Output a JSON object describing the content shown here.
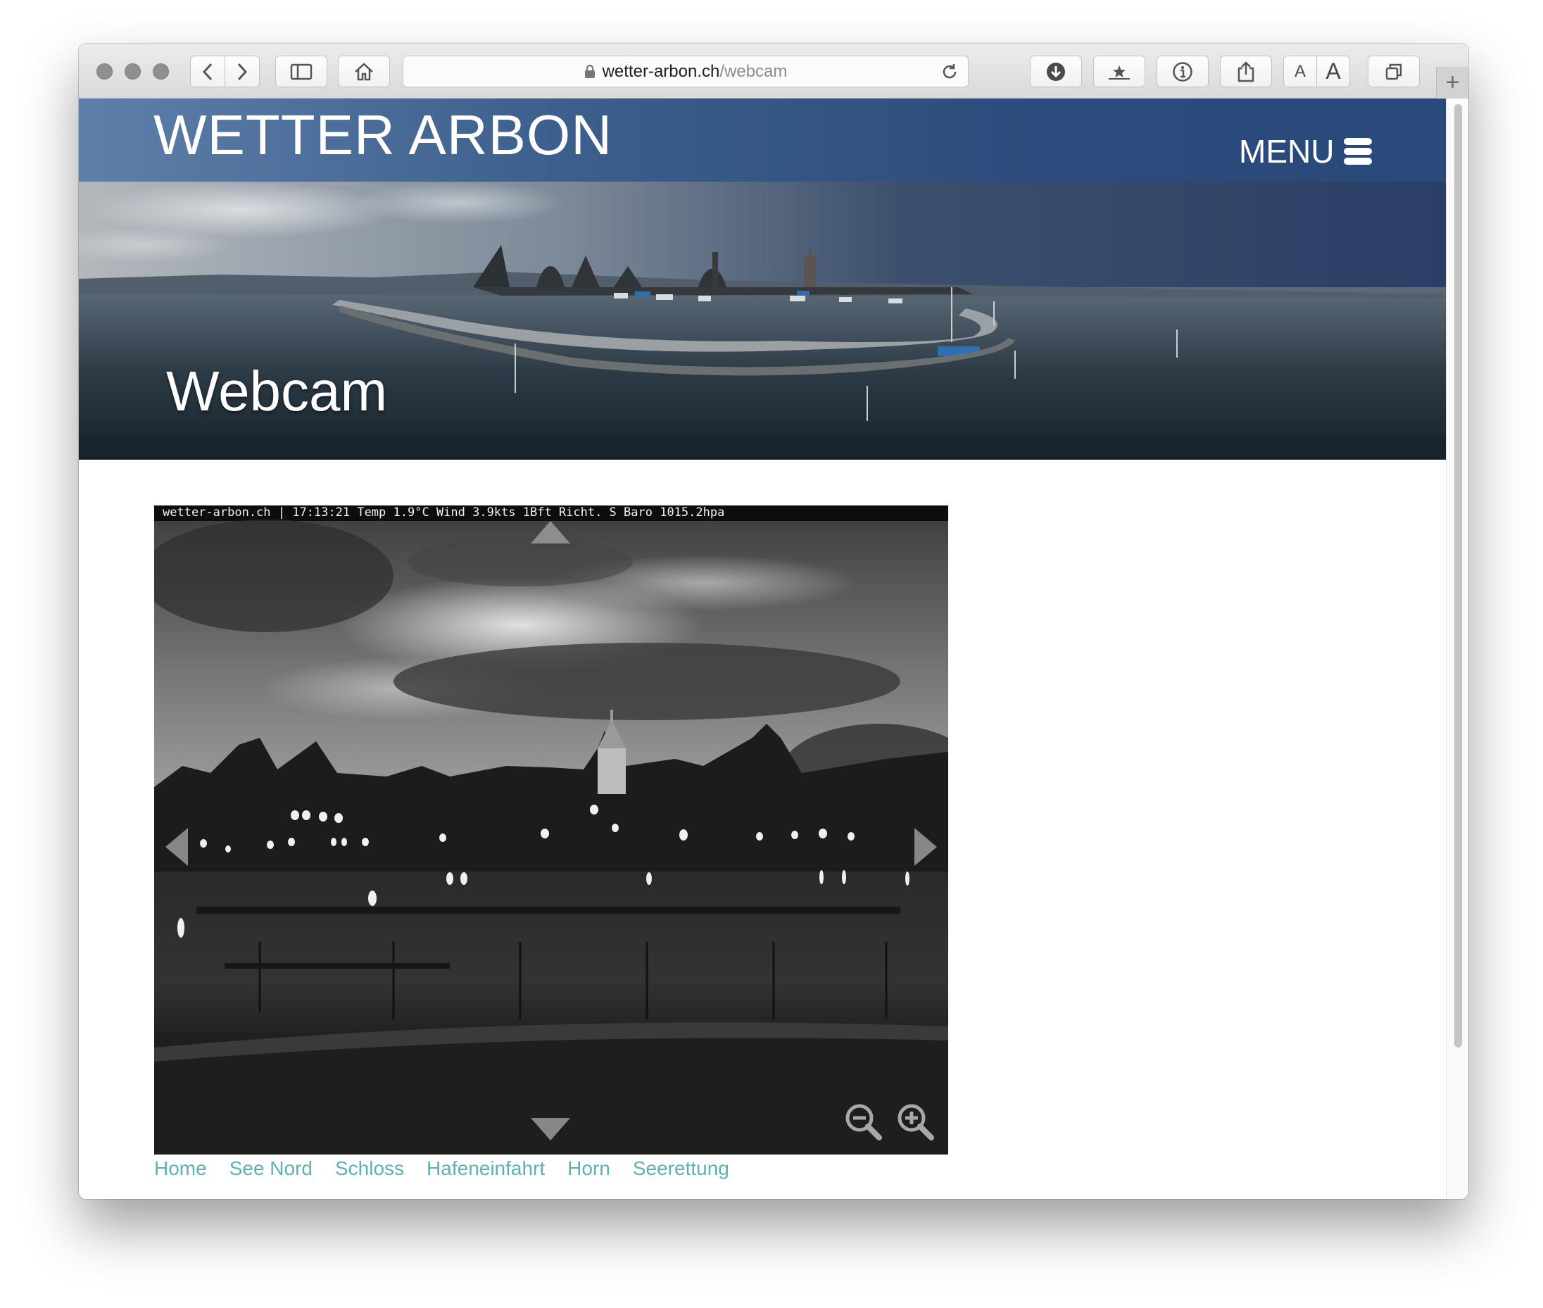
{
  "browser": {
    "url_host": "wetter-arbon.ch",
    "url_path": "/webcam",
    "new_tab_label": "+",
    "text_smaller": "A",
    "text_larger": "A"
  },
  "site": {
    "brand": "WETTER ARBON",
    "menu_label": "MENU",
    "page_title": "Webcam"
  },
  "webcam": {
    "overlay": "wetter-arbon.ch | 17:13:21  Temp 1.9°C Wind 3.9kts 1Bft Richt. S Baro 1015.2hpa"
  },
  "links": [
    {
      "label": "Home"
    },
    {
      "label": "See Nord"
    },
    {
      "label": "Schloss"
    },
    {
      "label": "Hafeneinfahrt"
    },
    {
      "label": "Horn"
    },
    {
      "label": "Seerettung"
    }
  ],
  "icons": [
    "close-light",
    "minimize-light",
    "zoom-light",
    "back-icon",
    "forward-icon",
    "sidebar-icon",
    "home-icon",
    "lock-icon",
    "reload-icon",
    "download-icon",
    "bookmarks-icon",
    "info-icon",
    "share-icon",
    "tabs-icon",
    "menu-icon",
    "zoom-out-icon",
    "zoom-in-icon"
  ]
}
